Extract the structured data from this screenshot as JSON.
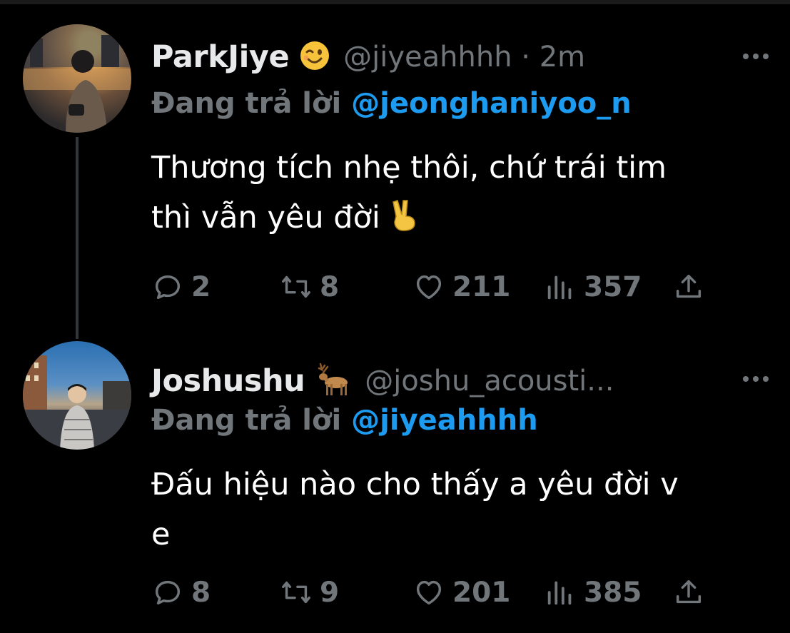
{
  "tweets": [
    {
      "display_name": "ParkJiye",
      "name_emoji": "😉",
      "handle_time": "@jiyeahhhh · 2m",
      "replying_label": "Đang trả lời",
      "replying_to": "@jeonghaniyoo_n",
      "text_line1": "Thương tích nhẹ thôi, chứ trái tim",
      "text_line2": "thì vẫn yêu đời",
      "text_emoji": "✌️",
      "stats": {
        "replies": "2",
        "retweets": "8",
        "likes": "211",
        "views": "357"
      }
    },
    {
      "display_name": "Joshushu",
      "name_emoji": "🦌",
      "handle_time": "@joshu_acousti...",
      "replying_label": "Đang trả lời",
      "replying_to": "@jiyeahhhh",
      "text_line1": "Đấu hiệu nào cho thấy a yêu đời v",
      "text_line2": "e",
      "stats": {
        "replies": "8",
        "retweets": "9",
        "likes": "201",
        "views": "385"
      }
    }
  ],
  "colors": {
    "background": "#000000",
    "text": "#e7e9ea",
    "secondary": "#71767b",
    "link": "#1d9bf0"
  },
  "icons": [
    "reply-icon",
    "retweet-icon",
    "like-icon",
    "views-icon",
    "share-icon",
    "more-icon"
  ]
}
